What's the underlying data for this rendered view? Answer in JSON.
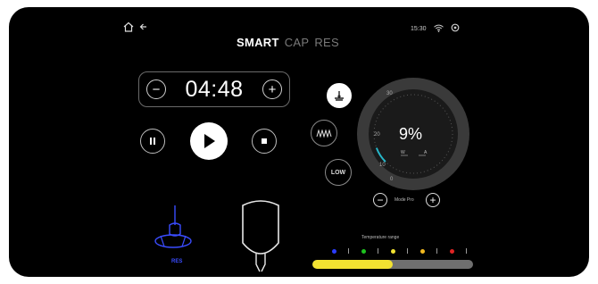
{
  "header": {
    "home_icon": "home-icon",
    "back_icon": "back-arrow-icon",
    "tabs": [
      {
        "label": "SMART",
        "active": true
      },
      {
        "label": "CAP",
        "active": false
      },
      {
        "label": "RES",
        "active": false
      }
    ],
    "time": "15:30",
    "wifi_icon": "wifi-icon",
    "settings_icon": "settings-icon"
  },
  "timer": {
    "value": "04:48",
    "minus_label": "−",
    "plus_label": "+"
  },
  "controls": {
    "pause_icon": "pause-icon",
    "play_icon": "play-icon",
    "stop_icon": "stop-icon"
  },
  "modes": {
    "top_icon": "electrode-icon",
    "wave_icon": "wave-icon",
    "level_label": "LOW"
  },
  "gauge": {
    "value_text": "9%",
    "value_percent": 9,
    "left_label": "W",
    "right_label": "A",
    "scale_labels": [
      "30",
      "20",
      "10",
      "0"
    ],
    "footer_label": "Mode Pro",
    "minus_label": "−",
    "plus_label": "+"
  },
  "accessory": {
    "label": "RES",
    "color": "#3a4cff"
  },
  "temperature": {
    "label": "Temperature range",
    "fill_percent": 50,
    "dot_colors": [
      "#2b3cff",
      "#1ec21e",
      "#f2e231",
      "#f2b920",
      "#e02424"
    ],
    "bar_color": "#f2e231",
    "track_color": "#6f6f6f"
  }
}
